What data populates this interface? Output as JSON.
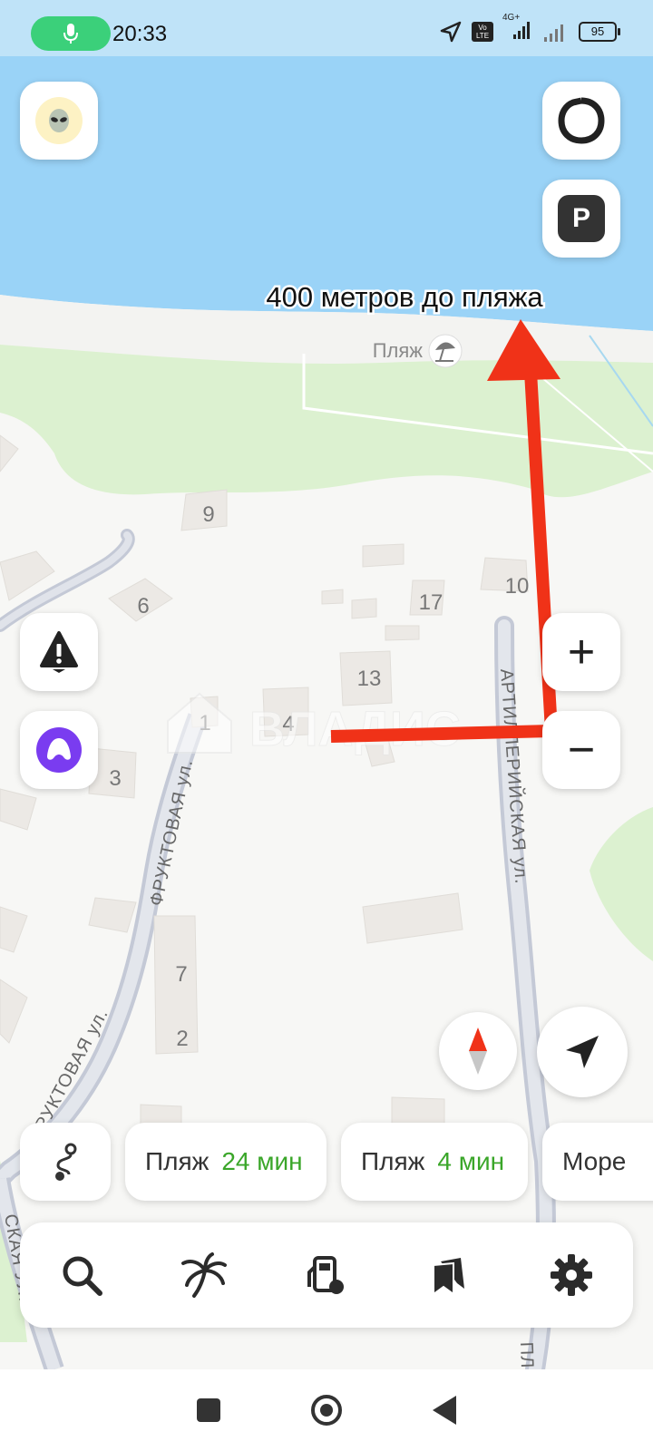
{
  "status_bar": {
    "time": "20:33",
    "battery": "95",
    "network": "4G+",
    "volte": "Vo LTE"
  },
  "map": {
    "annotation": "400 метров до пляжа",
    "beach_poi": "Пляж",
    "watermark": "ВЛАДИС",
    "streets": [
      "ФРУКТОВАЯ ул.",
      "ФРУКТОВАЯ ул.",
      "АРТИЛЛЕРИЙСКАЯ ул.",
      "СКАЯ УЛ.",
      "ПЛЕ"
    ],
    "house_numbers": [
      "9",
      "6",
      "10",
      "17",
      "13",
      "4",
      "1",
      "3",
      "7",
      "2"
    ],
    "colors": {
      "water": "#9ad3f7",
      "park": "#dcf1d0",
      "land": "#f7f7f5",
      "road": "#c4c9d6",
      "route_arrow": "#f03218",
      "alice": "#7a3cf0",
      "time_green": "#3aa629"
    }
  },
  "controls": {
    "profile_icon": "alien-avatar-icon",
    "alice_top_icon": "alice-ring-icon",
    "parking_label": "P",
    "zoom_in": "+",
    "zoom_out": "−"
  },
  "chips": [
    {
      "label": "Пляж",
      "time": "24 мин"
    },
    {
      "label": "Пляж",
      "time": "4 мин"
    },
    {
      "label": "Море",
      "time": ""
    }
  ],
  "bottom_nav": [
    "search-icon",
    "palm-tree-icon",
    "fuel-station-icon",
    "bookmarks-icon",
    "settings-icon"
  ]
}
